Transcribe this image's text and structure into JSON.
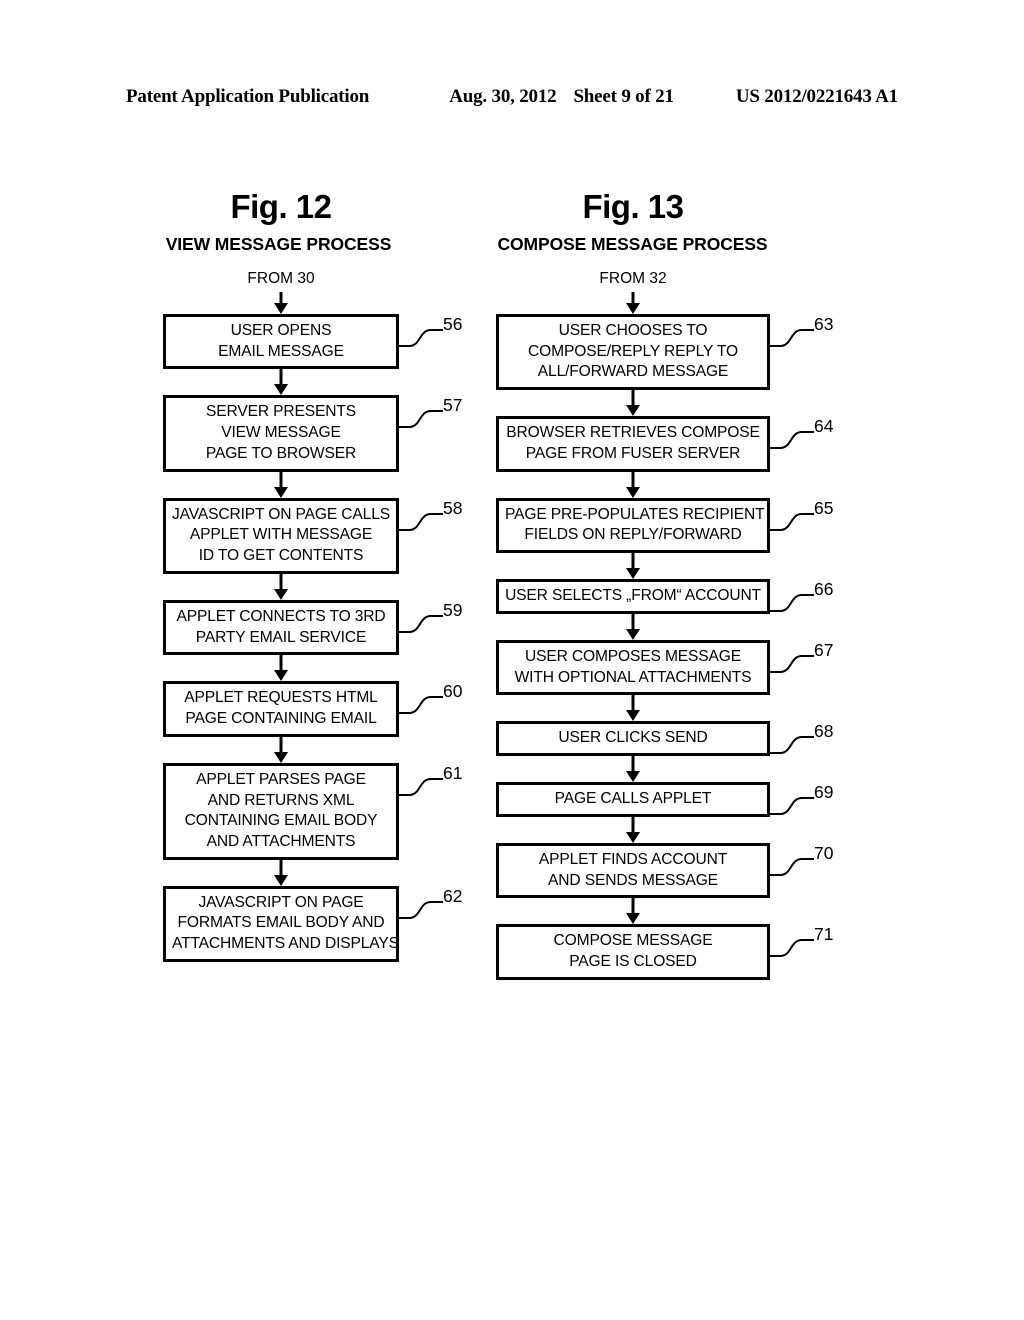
{
  "header": {
    "publication": "Patent Application Publication",
    "date": "Aug. 30, 2012",
    "sheet": "Sheet 9 of 21",
    "patent_number": "US 2012/0221643 A1"
  },
  "figures": [
    {
      "id": "fig12",
      "title": "Fig. 12",
      "subtitle": "VIEW MESSAGE PROCESS",
      "entry_label": "FROM 30",
      "steps": [
        {
          "ref": "56",
          "lines": [
            "USER OPENS",
            "EMAIL MESSAGE"
          ]
        },
        {
          "ref": "57",
          "lines": [
            "SERVER PRESENTS",
            "VIEW MESSAGE",
            "PAGE TO BROWSER"
          ]
        },
        {
          "ref": "58",
          "lines": [
            "JAVASCRIPT ON PAGE CALLS",
            "APPLET WITH MESSAGE",
            "ID TO GET CONTENTS"
          ]
        },
        {
          "ref": "59",
          "lines": [
            "APPLET CONNECTS TO 3RD",
            "PARTY EMAIL SERVICE"
          ]
        },
        {
          "ref": "60",
          "lines": [
            "APPLET REQUESTS HTML",
            "PAGE CONTAINING EMAIL"
          ]
        },
        {
          "ref": "61",
          "lines": [
            "APPLET PARSES PAGE",
            "AND RETURNS XML",
            "CONTAINING EMAIL BODY",
            "AND ATTACHMENTS"
          ]
        },
        {
          "ref": "62",
          "lines": [
            "JAVASCRIPT ON PAGE",
            "FORMATS EMAIL BODY AND",
            "ATTACHMENTS AND DISPLAYS"
          ]
        }
      ]
    },
    {
      "id": "fig13",
      "title": "Fig. 13",
      "subtitle": "COMPOSE MESSAGE PROCESS",
      "entry_label": "FROM 32",
      "steps": [
        {
          "ref": "63",
          "lines": [
            "USER CHOOSES TO",
            "COMPOSE/REPLY REPLY TO",
            "ALL/FORWARD MESSAGE"
          ]
        },
        {
          "ref": "64",
          "lines": [
            "BROWSER RETRIEVES COMPOSE",
            "PAGE FROM FUSER SERVER"
          ]
        },
        {
          "ref": "65",
          "lines": [
            "PAGE PRE-POPULATES RECIPIENT",
            "FIELDS ON REPLY/FORWARD"
          ]
        },
        {
          "ref": "66",
          "lines": [
            "USER SELECTS  „FROM“ ACCOUNT"
          ]
        },
        {
          "ref": "67",
          "lines": [
            "USER COMPOSES MESSAGE",
            "WITH OPTIONAL ATTACHMENTS"
          ]
        },
        {
          "ref": "68",
          "lines": [
            "USER CLICKS SEND"
          ]
        },
        {
          "ref": "69",
          "lines": [
            "PAGE CALLS APPLET"
          ]
        },
        {
          "ref": "70",
          "lines": [
            "APPLET FINDS ACCOUNT",
            "AND SENDS MESSAGE"
          ]
        },
        {
          "ref": "71",
          "lines": [
            "COMPOSE MESSAGE",
            "PAGE IS CLOSED"
          ]
        }
      ]
    }
  ]
}
